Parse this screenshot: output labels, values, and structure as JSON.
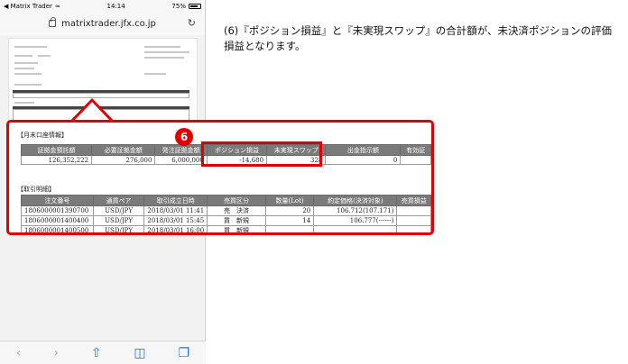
{
  "status_bar": {
    "carrier": "◀ Matrix Trader",
    "time": "14:14",
    "battery": "75%"
  },
  "address_bar": {
    "url": "matrixtrader.jfx.co.jp"
  },
  "description": "(6)『ポジション損益』と『未実現スワップ』の合計額が、未決済ポジションの評価損益となります。",
  "badge": "6",
  "account_section": {
    "title": "【月末口座情報】",
    "headers": [
      "証拠金預託額",
      "必要証拠金額",
      "発注証拠金額",
      "ポジション損益",
      "未実現スワップ",
      "出金指示額",
      "有効証"
    ],
    "row": [
      "126,352,222",
      "276,000",
      "6,000,000",
      "-14,680",
      "328",
      "0",
      ""
    ]
  },
  "trades_section": {
    "title": "【取引明細】",
    "headers": [
      "注文番号",
      "通貨ペア",
      "取引成立日時",
      "売買区分",
      "数量(Lot)",
      "約定価格(決済対象)",
      "売買損益"
    ],
    "rows": [
      [
        "1806000001390700",
        "USD/JPY",
        "2018/03/01 11:41",
        "売　決済",
        "20",
        "106.712(107.171)",
        ""
      ],
      [
        "1806000001400400",
        "USD/JPY",
        "2018/03/01 15:45",
        "買　新規",
        "14",
        "106.777(------)",
        ""
      ],
      [
        "1806000001400500",
        "USD/JPY",
        "2018/03/01 16:00",
        "買　新規",
        "",
        "",
        ""
      ]
    ]
  },
  "colors": {
    "highlight": "#e00000",
    "header_bg": "#7a7a7a"
  },
  "icons": [
    "back-icon",
    "forward-icon",
    "share-icon",
    "bookmarks-icon",
    "tabs-icon",
    "reload-icon",
    "lock-icon",
    "wifi-icon",
    "battery-icon"
  ]
}
